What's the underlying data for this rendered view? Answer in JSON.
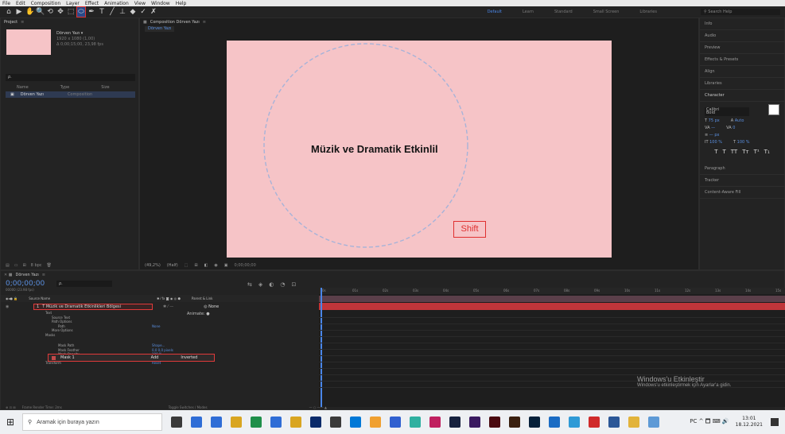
{
  "menu": [
    "File",
    "Edit",
    "Composition",
    "Layer",
    "Effect",
    "Animation",
    "View",
    "Window",
    "Help"
  ],
  "toolbar": {
    "tools": [
      "⌂",
      "▶",
      "✋",
      "🔍",
      "⟲",
      "✥",
      "⬚",
      "⬭",
      "✒",
      "T",
      "╱",
      "⊥",
      "◆",
      "✓",
      "✗"
    ],
    "workspaces": [
      "Default",
      "Learn",
      "Standard",
      "Small Screen",
      "Libraries"
    ],
    "search_placeholder": "Search Help"
  },
  "project": {
    "tab": "Project",
    "comp_name": "Dörven Yazı ▾",
    "comp_info1": "1920 x 1080 (1,00)",
    "comp_info2": "Δ 0;00;15;00, 23,98 fps",
    "search_placeholder": "ρ.",
    "col_name": "Name",
    "col_type": "Type",
    "col_size": "Size",
    "item_name": "Dörven Yazı",
    "item_type": "Composition",
    "bpc": "8 bpc"
  },
  "composition": {
    "tab": "Composition Dörven Yazı",
    "subtab": "Dörven Yazı",
    "canvas_text": "Müzik ve Dramatik Etkinlil",
    "shift_label": "Shift",
    "zoom": "(49,2%)",
    "quality": "(Half)",
    "timecode": "0;00;00;00",
    "canvas_color": "#f6c4c7"
  },
  "right_panel": {
    "items": [
      "Info",
      "Audio",
      "Preview",
      "Effects & Presets",
      "Align",
      "Libraries"
    ],
    "character": "Character",
    "font_family": "Calibri",
    "font_style": "Bold",
    "font_size": "75 px",
    "leading": "Auto",
    "tracking": "0",
    "scale": "100 %",
    "tt_row": [
      "T",
      "T",
      "TT",
      "Tт",
      "T¹",
      "T₁"
    ],
    "lower_items": [
      "Paragraph",
      "Tracker",
      "Content-Aware Fill"
    ]
  },
  "timeline": {
    "tab": "Dörven Yazı",
    "timecode": "0;00;00;00",
    "fps": "00000 (23.98 fps)",
    "col_source": "Source Name",
    "col_parent": "Parent & Link",
    "layer_index": "1",
    "layer_name": "T Müzik ve Dramatik Etkinlikleri Bölgesi",
    "parent": "None",
    "props": [
      {
        "label": "Text",
        "value": "",
        "indent": 1
      },
      {
        "label": "Source Text",
        "value": "",
        "indent": 2
      },
      {
        "label": "Path Options",
        "value": "",
        "indent": 2
      },
      {
        "label": "Path",
        "value": "None",
        "indent": 3
      },
      {
        "label": "More Options",
        "value": "",
        "indent": 2
      },
      {
        "label": "Masks",
        "value": "",
        "indent": 1
      },
      {
        "label": "Mask Path",
        "value": "Shape...",
        "indent": 3
      },
      {
        "label": "Mask Feather",
        "value": "0,0 0,0 pixels",
        "indent": 3
      },
      {
        "label": "Mask Opacity",
        "value": "100 %",
        "indent": 3
      },
      {
        "label": "Mask Expansion",
        "value": "0,0 pixels",
        "indent": 3
      },
      {
        "label": "Transform",
        "value": "Reset",
        "indent": 1
      }
    ],
    "animate_label": "Animate: ●",
    "mask_name": "Mask 1",
    "mask_mode": "Add",
    "mask_inverted": "Inverted",
    "ruler": [
      "0s",
      "01s",
      "02s",
      "03s",
      "04s",
      "05s",
      "06s",
      "07s",
      "08s",
      "09s",
      "10s",
      "11s",
      "12s",
      "13s",
      "14s",
      "15s"
    ],
    "footer_left": "Frame Render Time: 2ms",
    "footer_mid": "Toggle Switches / Modes"
  },
  "watermark": {
    "title": "Windows'u Etkinleştir",
    "subtitle": "Windows'u etkinleştirmek için Ayarlar'a gidin."
  },
  "taskbar": {
    "search_placeholder": "Aramak için buraya yazın",
    "tray": "PC ^ 🗖 ⌨ 🔊",
    "time": "13:01",
    "date": "18.12.2021",
    "icon_colors": [
      "#3a3a3a",
      "#2f6dd6",
      "#2f6dd6",
      "#d9a520",
      "#1f8f4a",
      "#2f6dd6",
      "#d9a520",
      "#0a2a6a",
      "#3a3a3a",
      "#0078d7",
      "#f0a030",
      "#3060d0",
      "#2fb0a0",
      "#c02060",
      "#16213e",
      "#3a1a60",
      "#4a0a10",
      "#3a2010",
      "#06203a",
      "#1b6cc4",
      "#2f9ad6",
      "#d02a2a",
      "#2b5797",
      "#e2b33a",
      "#5e9ad6"
    ]
  }
}
